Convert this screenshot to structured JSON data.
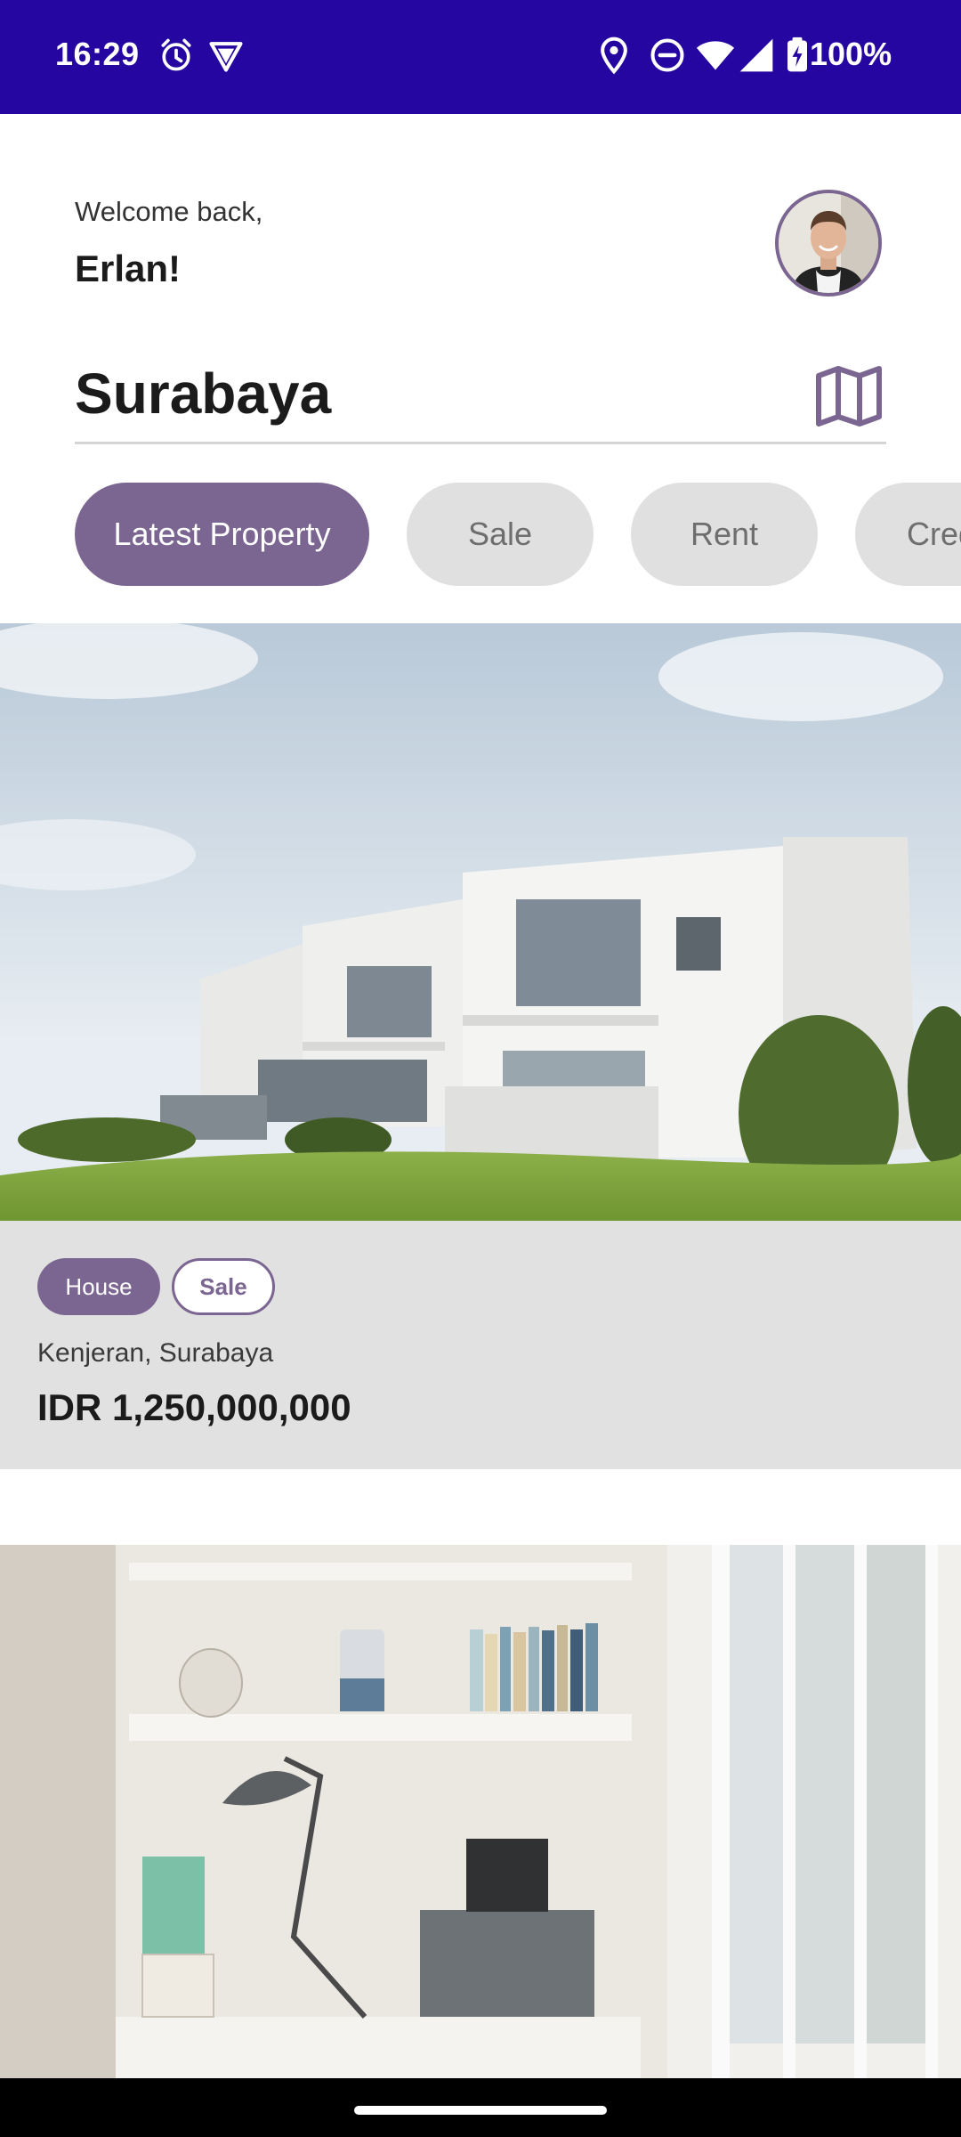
{
  "status_bar": {
    "time": "16:29",
    "battery": "100%",
    "icons": [
      "alarm-icon",
      "vpn-shield-icon",
      "location-icon",
      "do-not-disturb-icon",
      "wifi-icon",
      "signal-icon",
      "battery-charging-icon"
    ]
  },
  "header": {
    "greeting": "Welcome back,",
    "username": "Erlan!",
    "avatar_icon": "profile-avatar"
  },
  "location_bar": {
    "city": "Surabaya",
    "map_icon": "map-icon"
  },
  "filters": [
    {
      "label": "Latest Property",
      "active": true
    },
    {
      "label": "Sale",
      "active": false
    },
    {
      "label": "Rent",
      "active": false
    },
    {
      "label": "Credit",
      "active": false
    }
  ],
  "listings": [
    {
      "type_tag": "House",
      "status_tag": "Sale",
      "location": "Kenjeran, Surabaya",
      "price": "IDR 1,250,000,000"
    }
  ],
  "colors": {
    "status_bar": "#2506a0",
    "accent": "#7b6591",
    "chip_inactive": "#e0e0e0",
    "card_background": "#e1e1e1"
  }
}
